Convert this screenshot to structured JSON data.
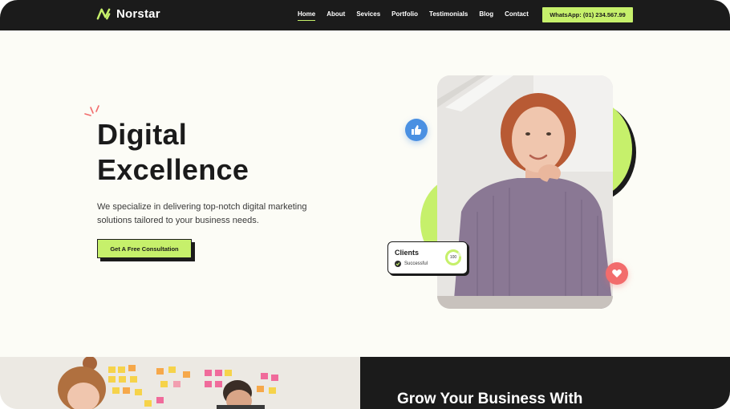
{
  "brand": {
    "name": "Norstar",
    "accent": "#c6f06b",
    "dark": "#1b1b1b"
  },
  "nav": {
    "links": [
      "Home",
      "About",
      "Sevices",
      "Portfolio",
      "Testimonials",
      "Blog",
      "Contact"
    ],
    "active": "Home",
    "whatsapp_label": "WhatsApp: (01) 234.567.99"
  },
  "hero": {
    "title": "Digital\nExcellence",
    "description": "We specialize in delivering top-notch digital marketing solutions tailored to your business needs.",
    "cta_label": "Get A Free Consultation"
  },
  "badges": {
    "like_icon": "thumbs-up-icon",
    "heart_icon": "heart-icon",
    "like_color": "#4a90e2",
    "heart_color": "#f26c6c"
  },
  "clients_card": {
    "title": "Clients",
    "status": "Successful",
    "ring_value": "100"
  },
  "section2": {
    "heading": "Grow Your Business With"
  }
}
